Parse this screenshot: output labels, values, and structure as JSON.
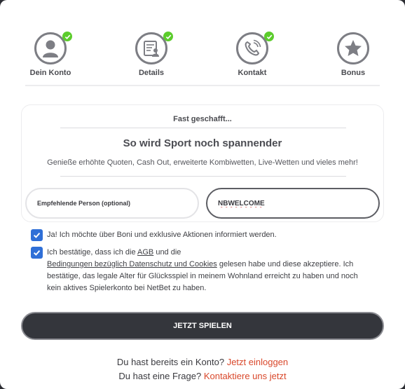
{
  "steps": [
    {
      "label": "Dein Konto",
      "icon": "user-icon",
      "completed": true
    },
    {
      "label": "Details",
      "icon": "document-user-icon",
      "completed": true
    },
    {
      "label": "Kontakt",
      "icon": "phone-icon",
      "completed": true
    },
    {
      "label": "Bonus",
      "icon": "star-icon",
      "completed": false
    }
  ],
  "card": {
    "kicker": "Fast geschafft...",
    "title": "So wird Sport noch spannender",
    "subtitle": "Genieße erhöhte Quoten, Cash Out, erweiterte Kombiwetten, Live-Wetten und vieles mehr!",
    "referrer_placeholder": "Empfehlende Person (optional)",
    "promo_value": "NBWELCOME"
  },
  "consents": {
    "marketing": {
      "checked": true,
      "text": "Ja! Ich möchte über Boni und exklusive Aktionen informiert werden."
    },
    "terms": {
      "checked": true,
      "part1": "Ich bestätige, dass ich die ",
      "agb_link": "AGB",
      "part2": " und die",
      "privacy_link": "Bedingungen bezüglich Datenschutz und Cookies",
      "part3": " gelesen habe und diese akzeptiere.",
      "part4": "Ich bestätige, das legale Alter für Glücksspiel in meinem Wohnland erreicht zu haben und noch kein aktives Spielerkonto bei NetBet zu haben."
    }
  },
  "submit_label": "JETZT SPIELEN",
  "footer": {
    "account_text": "Du hast bereits ein Konto?",
    "login_link": "Jetzt einloggen",
    "question_text": "Du hast eine Frage?",
    "contact_link": "Kontaktiere uns jetzt"
  },
  "colors": {
    "check_green": "#5ccc2c",
    "checkbox_blue": "#2f6fd7",
    "link_red": "#d9482b",
    "button_dark": "#34363c"
  }
}
